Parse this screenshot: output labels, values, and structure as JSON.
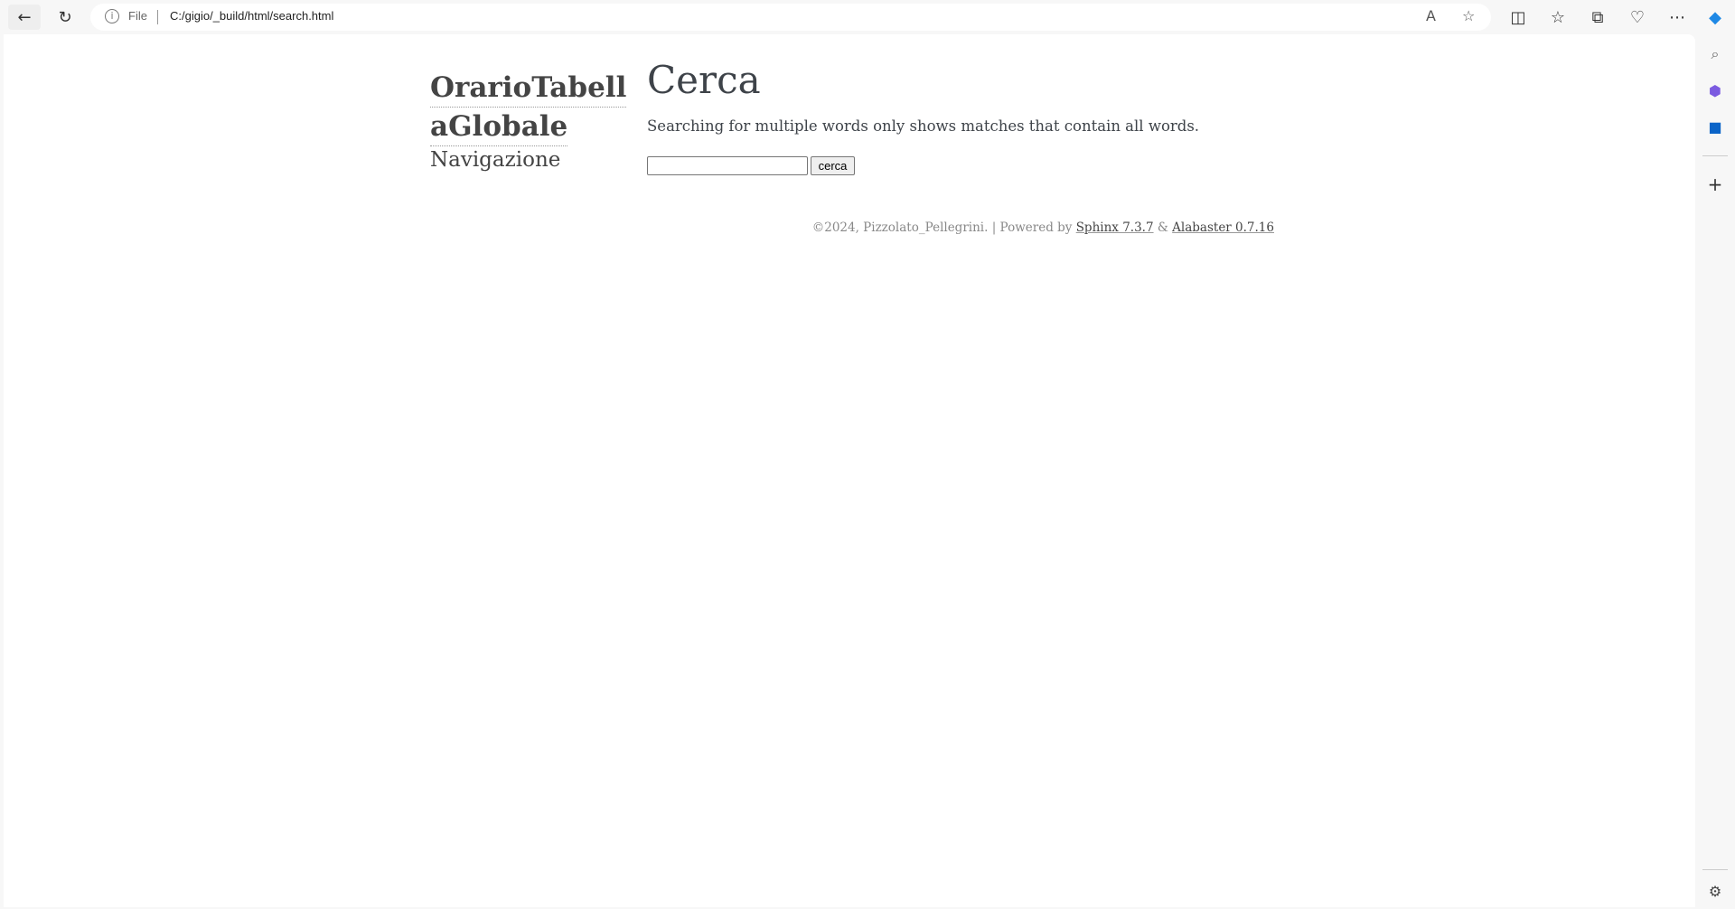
{
  "browser": {
    "file_label": "File",
    "url": "C:/gigio/_build/html/search.html"
  },
  "sidebar": {
    "title_line1": "OrarioTabell",
    "title_line2": "aGlobale",
    "nav_heading": "Navigazione"
  },
  "main": {
    "title": "Cerca",
    "hint": "Searching for multiple words only shows matches that contain all words.",
    "search_value": "",
    "button_label": "cerca"
  },
  "footer": {
    "copyright": "©2024, Pizzolato_Pellegrini.",
    "powered": " | Powered by ",
    "sphinx": "Sphinx 7.3.7",
    "amp": " & ",
    "alabaster": "Alabaster 0.7.16"
  }
}
